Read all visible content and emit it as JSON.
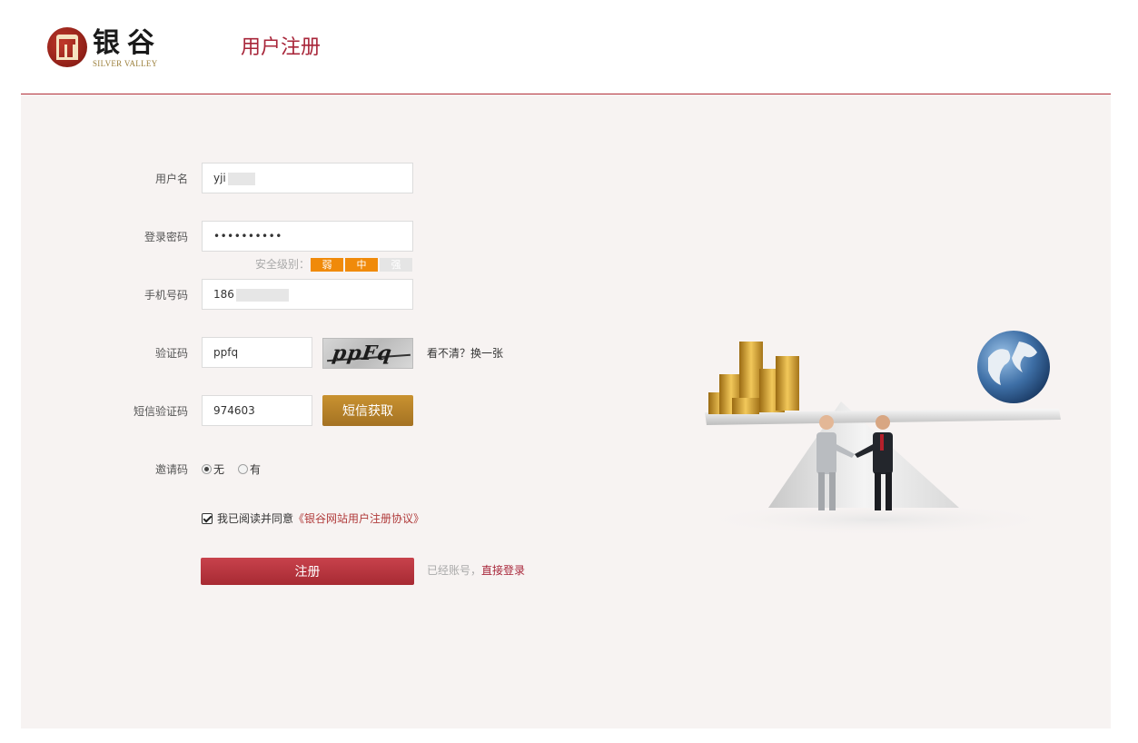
{
  "header": {
    "logo_cn": "银谷",
    "logo_en": "SILVER VALLEY",
    "page_title": "用户注册"
  },
  "form": {
    "username": {
      "label": "用户名",
      "value": "yji"
    },
    "password": {
      "label": "登录密码",
      "value": "••••••••••"
    },
    "strength": {
      "label": "安全级别：",
      "levels": [
        "弱",
        "中",
        "强"
      ],
      "active_count": 2,
      "active_color": "#f08a0a",
      "inactive_color": "#e5e5e5"
    },
    "phone": {
      "label": "手机号码",
      "value": "186"
    },
    "captcha": {
      "label": "验证码",
      "value": "ppfq",
      "image_text": "ppFq",
      "refresh_link": "看不清？换一张"
    },
    "sms": {
      "label": "短信验证码",
      "value": "974603",
      "button": "短信获取"
    },
    "invite": {
      "label": "邀请码",
      "options": [
        "无",
        "有"
      ],
      "selected": "无"
    },
    "agreement": {
      "checked": true,
      "text": "我已阅读并同意",
      "link": "《银谷网站用户注册协议》"
    },
    "submit": "注册",
    "login_hint": "已经账号，",
    "login_link": "直接登录"
  },
  "colors": {
    "brand": "#a8263a",
    "button": "#b9353f",
    "sms_button": "#b58226",
    "background": "#f7f3f2"
  }
}
